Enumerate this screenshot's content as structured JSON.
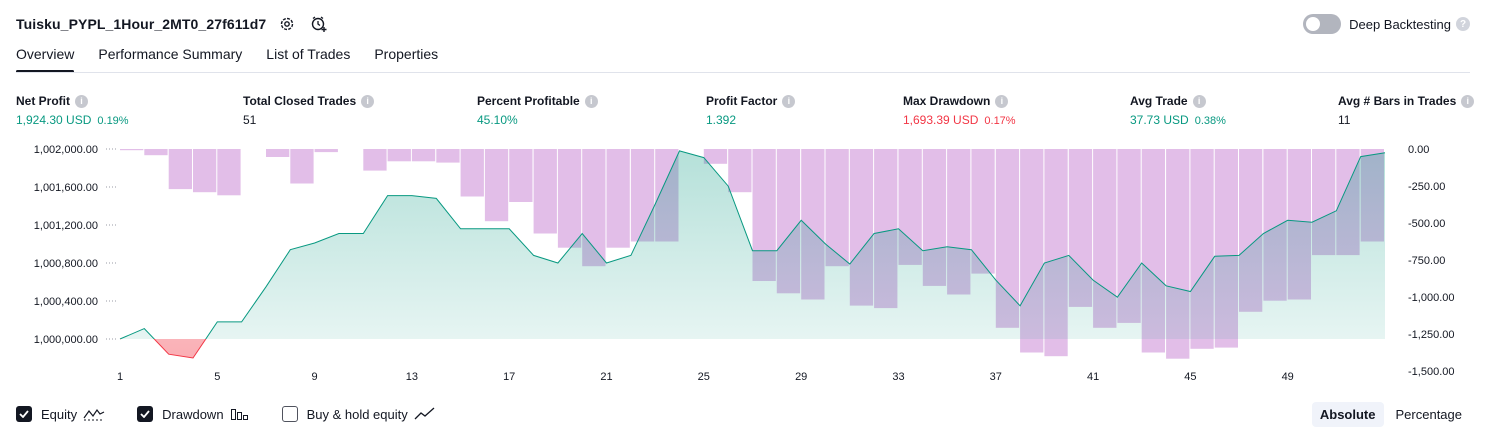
{
  "header": {
    "title": "Tuisku_PYPL_1Hour_2MT0_27f611d7",
    "deep_backtesting_label": "Deep Backtesting",
    "deep_backtesting_enabled": false,
    "help_glyph": "?"
  },
  "tabs": [
    {
      "label": "Overview",
      "active": true
    },
    {
      "label": "Performance Summary",
      "active": false
    },
    {
      "label": "List of Trades",
      "active": false
    },
    {
      "label": "Properties",
      "active": false
    }
  ],
  "metrics": [
    {
      "label": "Net Profit",
      "value": "1,924.30 USD",
      "pct": "0.19%",
      "color": "green"
    },
    {
      "label": "Total Closed Trades",
      "value": "51",
      "pct": "",
      "color": "dark"
    },
    {
      "label": "Percent Profitable",
      "value": "45.10%",
      "pct": "",
      "color": "green"
    },
    {
      "label": "Profit Factor",
      "value": "1.392",
      "pct": "",
      "color": "green"
    },
    {
      "label": "Max Drawdown",
      "value": "1,693.39 USD",
      "pct": "0.17%",
      "color": "red"
    },
    {
      "label": "Avg Trade",
      "value": "37.73 USD",
      "pct": "0.38%",
      "color": "green"
    },
    {
      "label": "Avg # Bars in Trades",
      "value": "11",
      "pct": "",
      "color": "dark"
    }
  ],
  "info_glyph": "i",
  "legend": [
    {
      "label": "Equity",
      "checked": true,
      "icon": "equity-line-icon"
    },
    {
      "label": "Drawdown",
      "checked": true,
      "icon": "drawdown-bars-icon"
    },
    {
      "label": "Buy & hold equity",
      "checked": false,
      "icon": "buy-hold-line-icon"
    }
  ],
  "mode": {
    "absolute_label": "Absolute",
    "percentage_label": "Percentage",
    "selected": "Absolute"
  },
  "colors": {
    "equity": "#089981",
    "drawdown": "#ce93d8",
    "negative": "#f23645",
    "text": "#131722"
  },
  "chart_data": {
    "type": "area",
    "x_ticks": [
      "1",
      "5",
      "9",
      "13",
      "17",
      "21",
      "25",
      "29",
      "33",
      "37",
      "41",
      "45",
      "49"
    ],
    "xlim": [
      1,
      53
    ],
    "left_axis": {
      "ticks": [
        "1,002,000.00",
        "1,001,600.00",
        "1,001,200.00",
        "1,000,800.00",
        "1,000,400.00",
        "1,000,000.00"
      ],
      "ylim": [
        999790,
        1002000
      ]
    },
    "right_axis": {
      "ticks": [
        "0.00",
        "-250.00",
        "-500.00",
        "-750.00",
        "-1,000.00",
        "-1,250.00",
        "-1,500.00"
      ],
      "ylim": [
        -1700,
        0
      ]
    },
    "baseline": 1000000,
    "series": [
      {
        "name": "Equity",
        "x": [
          1,
          2,
          3,
          4,
          5,
          6,
          7,
          8,
          9,
          10,
          11,
          12,
          13,
          14,
          15,
          16,
          17,
          18,
          19,
          20,
          21,
          22,
          23,
          24,
          25,
          26,
          27,
          28,
          29,
          30,
          31,
          32,
          33,
          34,
          35,
          36,
          37,
          38,
          39,
          40,
          41,
          42,
          43,
          44,
          45,
          46,
          47,
          48,
          49,
          50,
          51,
          52,
          53
        ],
        "values": [
          1000000,
          1000110,
          999840,
          999800,
          1000180,
          1000180,
          1000550,
          1000940,
          1001010,
          1001110,
          1001110,
          1001510,
          1001510,
          1001480,
          1001160,
          1001160,
          1001160,
          1000880,
          1000800,
          1001110,
          1000800,
          1000880,
          1001420,
          1001980,
          1001910,
          1001610,
          1000930,
          1000930,
          1001250,
          1001000,
          1000790,
          1001110,
          1001160,
          1000930,
          1000970,
          1000940,
          1000620,
          1000350,
          1000800,
          1000880,
          1000620,
          1000440,
          1000800,
          1000560,
          1000500,
          1000870,
          1000880,
          1001110,
          1001250,
          1001230,
          1001350,
          1001920,
          1001960
        ]
      },
      {
        "name": "Drawdown",
        "x": [
          1,
          2,
          3,
          4,
          5,
          6,
          7,
          8,
          9,
          10,
          11,
          12,
          13,
          14,
          15,
          16,
          17,
          18,
          19,
          20,
          21,
          22,
          23,
          24,
          25,
          26,
          27,
          28,
          29,
          30,
          31,
          32,
          33,
          34,
          35,
          36,
          37,
          38,
          39,
          40,
          41,
          42,
          43,
          44,
          45,
          46,
          47,
          48,
          49,
          50,
          51,
          52
        ],
        "values": [
          -10,
          -50,
          -325,
          -350,
          -375,
          0,
          -65,
          -280,
          -25,
          0,
          -175,
          -100,
          -100,
          -110,
          -385,
          -585,
          -430,
          -685,
          -800,
          -950,
          -800,
          -750,
          -750,
          0,
          -120,
          -350,
          -1070,
          -1170,
          -1220,
          -950,
          -1270,
          -1290,
          -940,
          -1110,
          -1180,
          -1010,
          -1450,
          -1650,
          -1680,
          -1280,
          -1450,
          -1410,
          -1650,
          -1700,
          -1620,
          -1610,
          -1320,
          -1230,
          -1220,
          -860,
          -860,
          -750
        ]
      }
    ]
  }
}
